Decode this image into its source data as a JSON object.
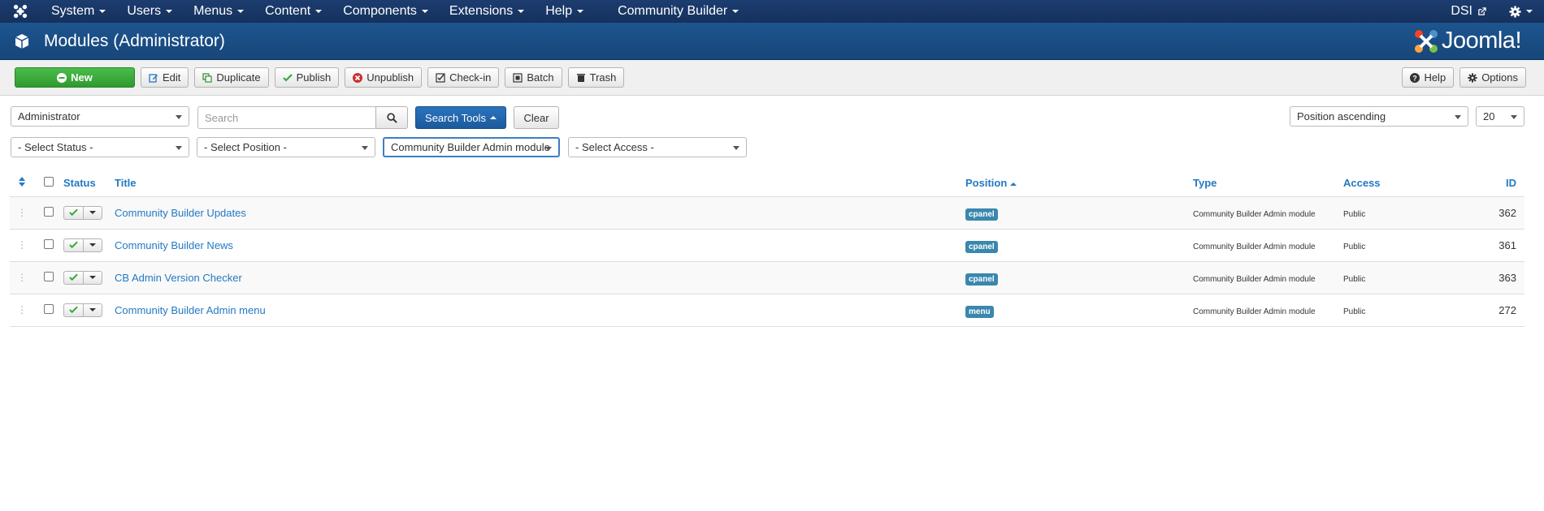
{
  "navbar": {
    "menus": [
      "System",
      "Users",
      "Menus",
      "Content",
      "Components",
      "Extensions",
      "Help"
    ],
    "extra_menu": "Community Builder",
    "user": "DSI"
  },
  "header": {
    "title": "Modules (Administrator)",
    "brand": "Joomla!"
  },
  "toolbar": {
    "new": "New",
    "edit": "Edit",
    "duplicate": "Duplicate",
    "publish": "Publish",
    "unpublish": "Unpublish",
    "checkin": "Check-in",
    "batch": "Batch",
    "trash": "Trash",
    "help": "Help",
    "options": "Options"
  },
  "filters": {
    "client": "Administrator",
    "search_placeholder": "Search",
    "search_tools": "Search Tools",
    "clear": "Clear",
    "ordering": "Position ascending",
    "limit": "20",
    "status": "- Select Status -",
    "position": "- Select Position -",
    "module": "Community Builder Admin module",
    "access": "- Select Access -"
  },
  "table": {
    "headers": {
      "status": "Status",
      "title": "Title",
      "position": "Position",
      "type": "Type",
      "access": "Access",
      "id": "ID"
    },
    "rows": [
      {
        "title": "Community Builder Updates",
        "position": "cpanel",
        "type": "Community Builder Admin module",
        "access": "Public",
        "id": "362"
      },
      {
        "title": "Community Builder News",
        "position": "cpanel",
        "type": "Community Builder Admin module",
        "access": "Public",
        "id": "361"
      },
      {
        "title": "CB Admin Version Checker",
        "position": "cpanel",
        "type": "Community Builder Admin module",
        "access": "Public",
        "id": "363"
      },
      {
        "title": "Community Builder Admin menu",
        "position": "menu",
        "type": "Community Builder Admin module",
        "access": "Public",
        "id": "272"
      }
    ]
  }
}
